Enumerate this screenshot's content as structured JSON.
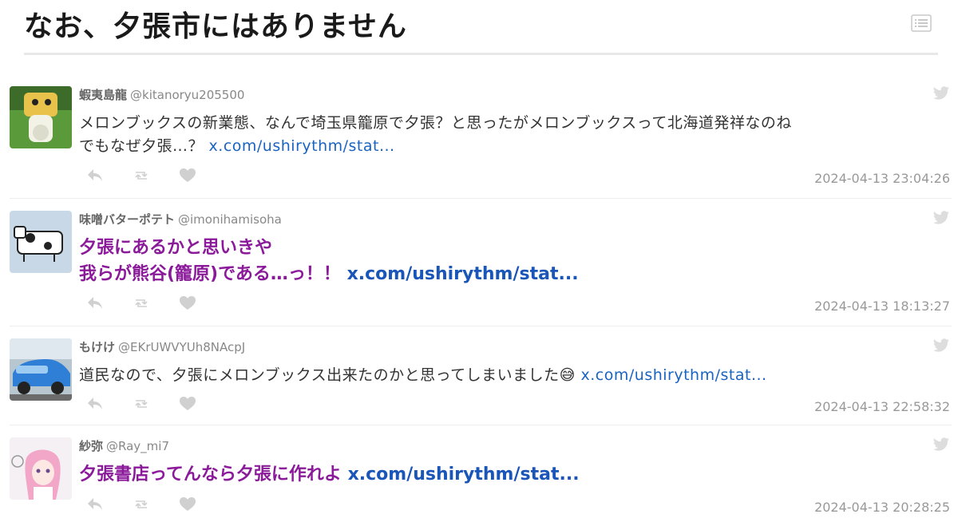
{
  "header": {
    "title": "なお、夕張市にはありません"
  },
  "tweets": [
    {
      "name": "蝦夷島龍",
      "handle": "@kitanoryu205500",
      "line1": "メロンブックスの新業態、なんで埼玉県籠原で夕張？と思ったがメロンブックスって北海道発祥なのね",
      "line2": "でもなぜ夕張…？ ",
      "link": "x.com/ushirythm/stat...",
      "timestamp": "2024-04-13 23:04:26"
    },
    {
      "name": "味噌バターポテト",
      "handle": "@imonihamisoha",
      "line1": "夕張にあるかと思いきや",
      "line2": "我らが熊谷(籠原)である…っ！！ ",
      "link": "x.com/ushirythm/stat...",
      "timestamp": "2024-04-13 18:13:27"
    },
    {
      "name": "もけけ",
      "handle": "@EKrUWVYUh8NAcpJ",
      "line1": "道民なので、夕張にメロンブックス出来たのかと思ってしまいました",
      "emoji": "😅",
      "link": "x.com/ushirythm/stat...",
      "timestamp": "2024-04-13 22:58:32"
    },
    {
      "name": "紗弥",
      "handle": "@Ray_mi7",
      "line1": "夕張書店ってんなら夕張に作れよ ",
      "link": "x.com/ushirythm/stat...",
      "timestamp": "2024-04-13 20:28:25"
    }
  ],
  "colors": {
    "accent_purple": "#8b1a9a",
    "link_blue": "#1a63c2",
    "muted_gray": "#999999"
  },
  "icons": [
    "list-icon",
    "twitter-bird-icon",
    "reply-icon",
    "retweet-icon",
    "like-icon"
  ]
}
